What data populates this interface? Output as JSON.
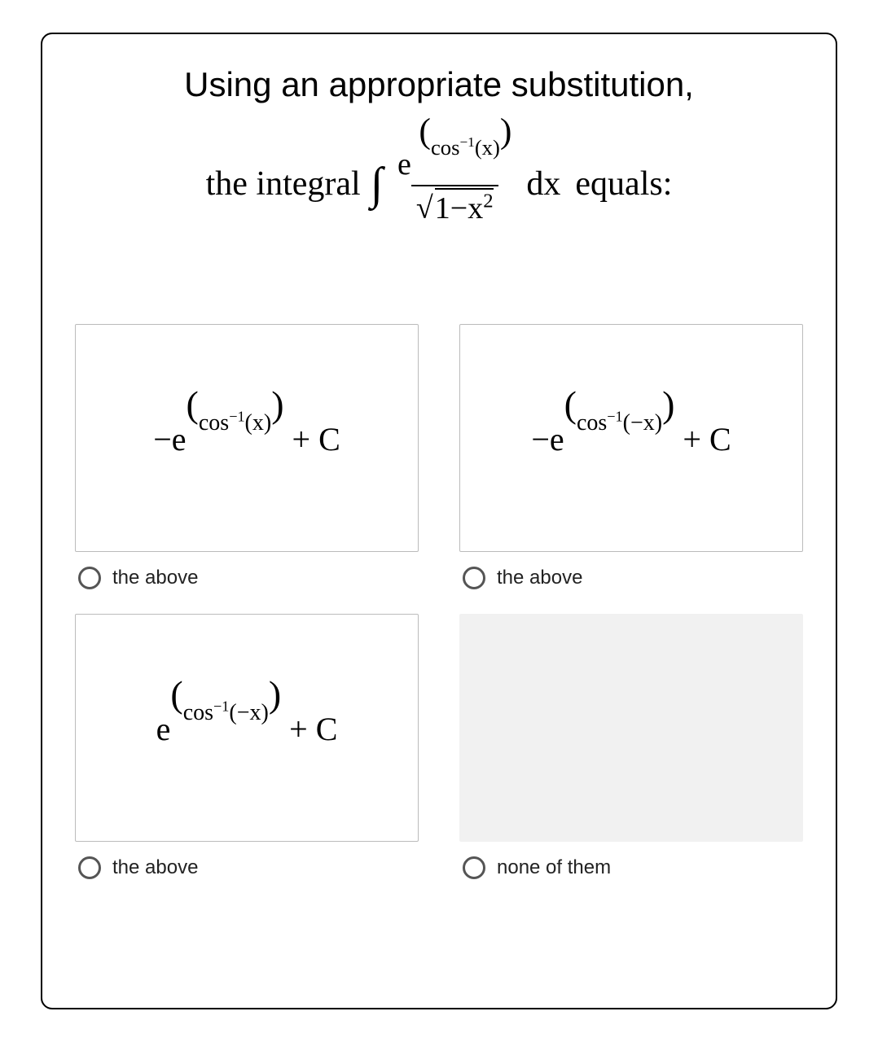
{
  "question": {
    "line1": "Using an appropriate substitution,",
    "line2_prefix": "the integral",
    "line2_suffix": "equals:",
    "integral_numerator": "e^(cos⁻¹(x))",
    "integral_denominator": "√(1−x²)",
    "integral_dx": "dx"
  },
  "options": [
    {
      "id": "a",
      "expression": "−e^(cos⁻¹(x)) + C",
      "label": "the above",
      "blank": false
    },
    {
      "id": "b",
      "expression": "−e^(cos⁻¹(−x)) + C",
      "label": "the above",
      "blank": false
    },
    {
      "id": "c",
      "expression": "e^(cos⁻¹(−x)) + C",
      "label": "the above",
      "blank": false
    },
    {
      "id": "d",
      "expression": "",
      "label": "none of them",
      "blank": true
    }
  ]
}
